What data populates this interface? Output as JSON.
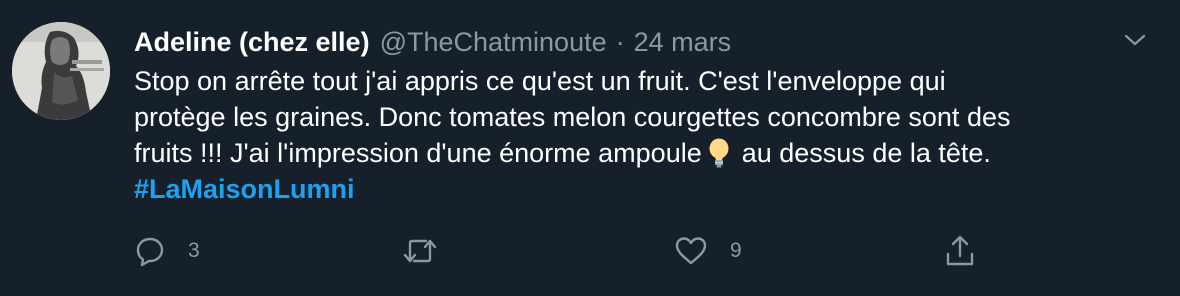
{
  "tweet": {
    "display_name": "Adeline (chez elle)",
    "handle": "@TheChatminoute",
    "separator": "·",
    "date": "24 mars",
    "text_line1": "Stop on arrête tout j'ai appris ce qu'est un fruit. C'est l'enveloppe qui",
    "text_line2": "protège les graines. Donc tomates melon courgettes concombre sont des",
    "text_line3_before": "fruits !!! J'ai l'impression d'une énorme ampoule",
    "text_line3_after": "au dessus de la tête.",
    "emoji": "lightbulb-emoji",
    "hashtag": "#LaMaisonLumni"
  },
  "actions": {
    "reply_count": "3",
    "like_count": "9"
  },
  "icons": {
    "reply": "reply-icon",
    "retweet": "retweet-icon",
    "like": "heart-icon",
    "share": "share-icon",
    "menu": "chevron-down-icon"
  },
  "colors": {
    "background": "#15202b",
    "text": "#ffffff",
    "secondary": "#8899a6",
    "link": "#1da1f2"
  }
}
